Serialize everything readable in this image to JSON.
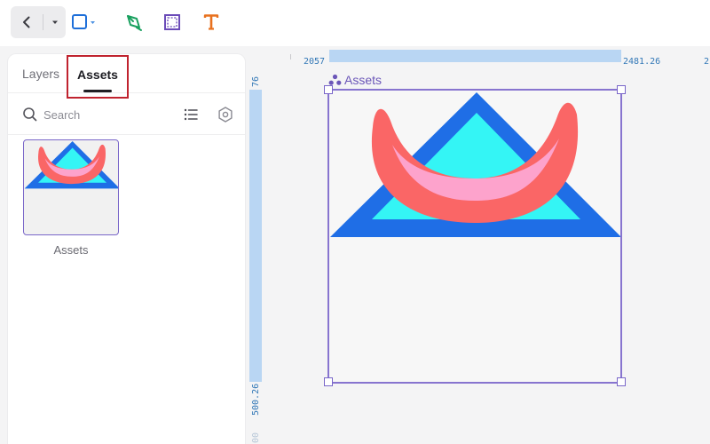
{
  "toolbar": {
    "back_icon": "chevron-left-icon",
    "dropdown_icon": "caret-down-icon",
    "tools": [
      {
        "name": "rectangle-tool",
        "icon": "rectangle-icon",
        "color": "#1e6fd9"
      },
      {
        "name": "pen-tool",
        "icon": "pen-icon",
        "color": "#19a05f"
      },
      {
        "name": "frame-tool",
        "icon": "frame-icon",
        "color": "#6b4bb8"
      },
      {
        "name": "text-tool",
        "icon": "text-icon",
        "color": "#e8711e"
      }
    ]
  },
  "sidebar": {
    "tabs": [
      {
        "label": "Layers",
        "active": false
      },
      {
        "label": "Assets",
        "active": true
      }
    ],
    "search": {
      "placeholder": "Search",
      "value": ""
    },
    "assets": [
      {
        "label": "Assets"
      }
    ]
  },
  "canvas": {
    "ruler": {
      "x_start": "2057",
      "x_end": "2481.26",
      "x_next": "2",
      "y_start": "76",
      "y_end": "500.26",
      "y_next": "00"
    },
    "frame": {
      "title": "Assets",
      "icon": "component-icon",
      "selection_color": "#8774cf"
    },
    "artwork_colors": {
      "triangle_outline": "#1f6ee6",
      "triangle_fill": "#34f5f5",
      "smile_outline": "#fa6666",
      "smile_fill": "#fda3cc"
    }
  }
}
